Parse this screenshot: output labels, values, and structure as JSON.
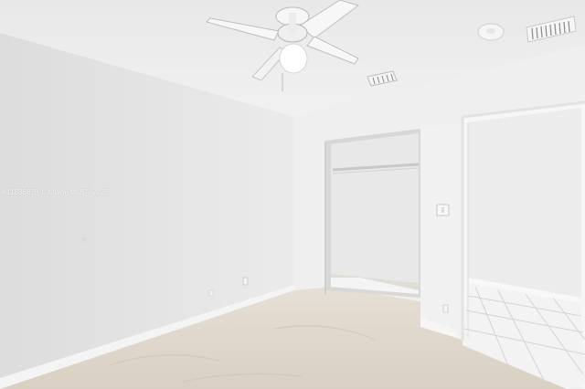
{
  "image": {
    "watermark_text": "A11836839 © Miami MLS® 2025",
    "colors": {
      "ceiling": "#ececec",
      "left_wall": "#e4e4e4",
      "back_wall": "#f0f0f0",
      "closet_interior": "#e7e7e7",
      "concrete_floor": "#e0d8cc",
      "tile_floor": "#f2f2f2",
      "grout": "#d6d6d6"
    },
    "objects": [
      "ceiling-fan",
      "ceiling-vent",
      "smoke-detector",
      "closet",
      "closet-rod",
      "doorway",
      "light-switch",
      "electrical-outlet"
    ]
  }
}
